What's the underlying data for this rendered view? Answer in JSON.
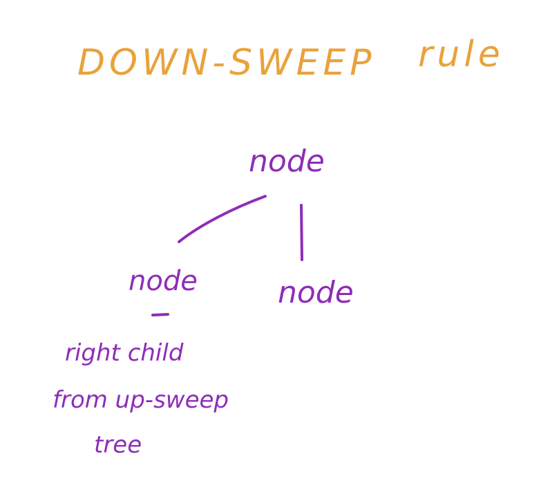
{
  "title": {
    "main": "DOWN-SWEEP",
    "suffix": "rule"
  },
  "nodes": {
    "root": "node",
    "left": "node",
    "right": "node"
  },
  "annotation": {
    "lines": [
      "right child",
      "from up-sweep",
      "tree"
    ]
  },
  "colors": {
    "title": "#E9A23B",
    "ink": "#8E2DB8"
  }
}
